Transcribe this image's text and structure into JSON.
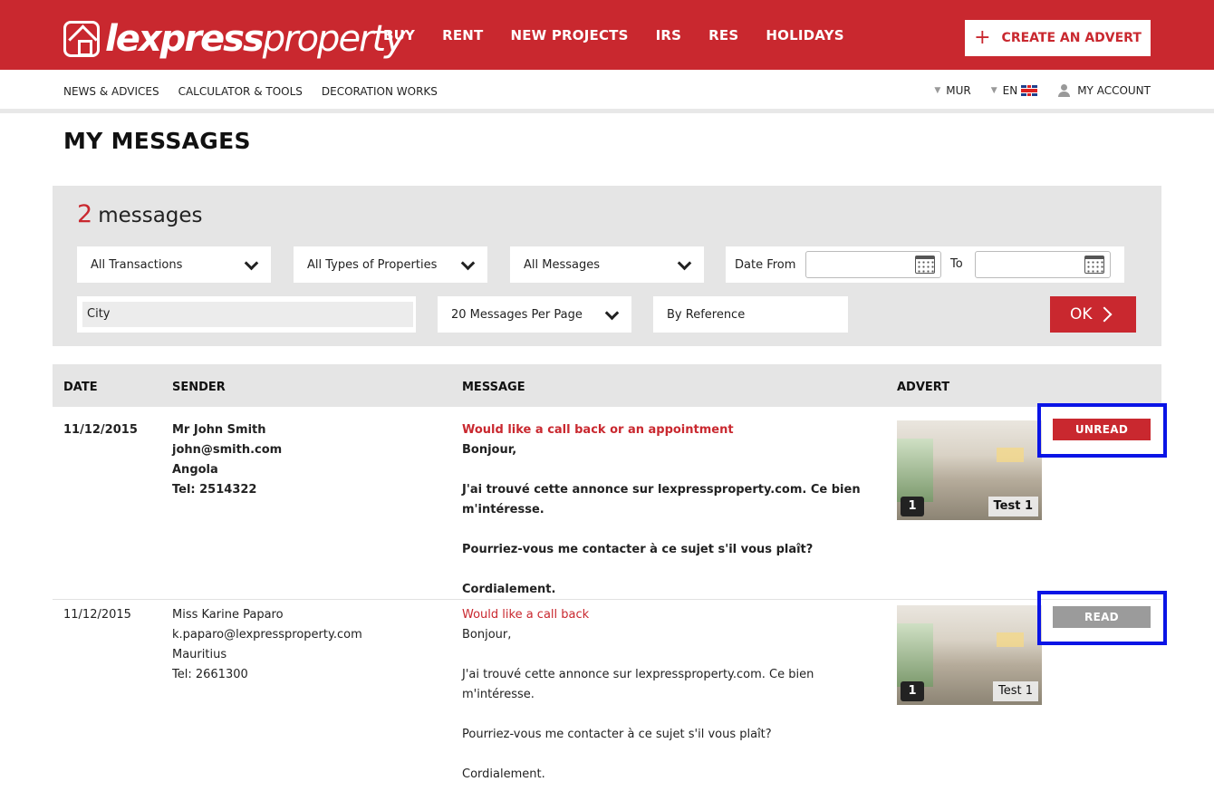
{
  "brand": {
    "logo_bold": "lexpress",
    "logo_light": "property"
  },
  "main_nav": [
    "BUY",
    "RENT",
    "NEW PROJECTS",
    "IRS",
    "RES",
    "HOLIDAYS"
  ],
  "create_advert": {
    "icon": "plus-icon",
    "label": "CREATE AN ADVERT"
  },
  "sub_nav": [
    "NEWS & ADVICES",
    "CALCULATOR & TOOLS",
    "DECORATION WORKS"
  ],
  "currency": "MUR",
  "language": "EN",
  "account": "MY ACCOUNT",
  "page_title": "MY MESSAGES",
  "filters": {
    "count": "2",
    "count_label": "messages",
    "transactions": "All Transactions",
    "property_types": "All Types of Properties",
    "messages": "All Messages",
    "date_from_label": "Date From",
    "date_to_label": "To",
    "date_from_value": "",
    "date_to_value": "",
    "city_placeholder": "City",
    "per_page": "20 Messages Per Page",
    "reference_placeholder": "By Reference",
    "ok_label": "OK"
  },
  "table": {
    "headers": {
      "date": "DATE",
      "sender": "SENDER",
      "message": "MESSAGE",
      "advert": "ADVERT"
    },
    "rows": [
      {
        "date": "11/12/2015",
        "sender_name": "Mr John Smith",
        "sender_email": "john@smith.com",
        "sender_country": "Angola",
        "sender_tel": "Tel: 2514322",
        "subject": "Would like a call back or an appointment",
        "greeting": "Bonjour,",
        "body1": "J'ai trouvé cette annonce sur lexpressproperty.com. Ce bien m'intéresse.",
        "body2": "Pourriez-vous me contacter à ce sujet s'il vous plaît?",
        "closing": "Cordialement.",
        "advert_count": "1",
        "advert_label": "Test 1",
        "status": "UNREAD"
      },
      {
        "date": "11/12/2015",
        "sender_name": "Miss Karine Paparo",
        "sender_email": "k.paparo@lexpressproperty.com",
        "sender_country": "Mauritius",
        "sender_tel": "Tel: 2661300",
        "subject": "Would like a call back",
        "greeting": "Bonjour,",
        "body1": "J'ai trouvé cette annonce sur lexpressproperty.com. Ce bien m'intéresse.",
        "body2": "Pourriez-vous me contacter à ce sujet s'il vous plaît?",
        "closing": "Cordialement.",
        "advert_count": "1",
        "advert_label": "Test 1",
        "status": "READ"
      }
    ]
  },
  "colors": {
    "brand_red": "#c9282f",
    "panel_gray": "#e5e5e5",
    "read_gray": "#9b9b9b",
    "highlight_blue": "#0a14e6"
  }
}
